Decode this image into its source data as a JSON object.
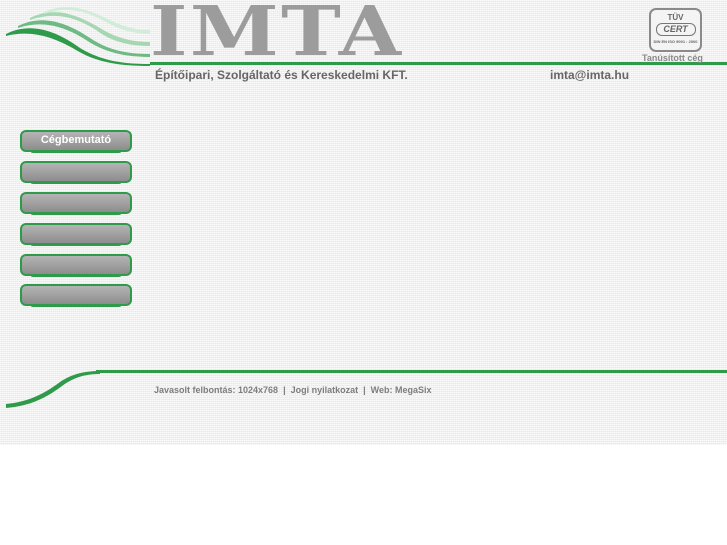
{
  "header": {
    "logo_text": "IMTA",
    "tagline": "Építőipari, Szolgáltató és Kereskedelmi KFT.",
    "email": "imta@imta.hu"
  },
  "certification": {
    "badge_top": "TÜV",
    "badge_main": "CERT",
    "badge_standard": "DIN EN ISO 9001 : 2000",
    "caption": "Tanúsított cég"
  },
  "nav": {
    "items": [
      {
        "label": "Cégbemutató"
      },
      {
        "label": ""
      },
      {
        "label": ""
      },
      {
        "label": ""
      },
      {
        "label": ""
      },
      {
        "label": ""
      }
    ]
  },
  "footer": {
    "resolution_text": "Javasolt felbontás: 1024x768",
    "separator": "|",
    "legal_link": "Jogi nyilatkozat",
    "web_text": "Web: MegaSix"
  },
  "colors": {
    "brand_green": "#2f9a4a",
    "logo_gray": "#9c9c9c",
    "text_gray": "#666666"
  }
}
